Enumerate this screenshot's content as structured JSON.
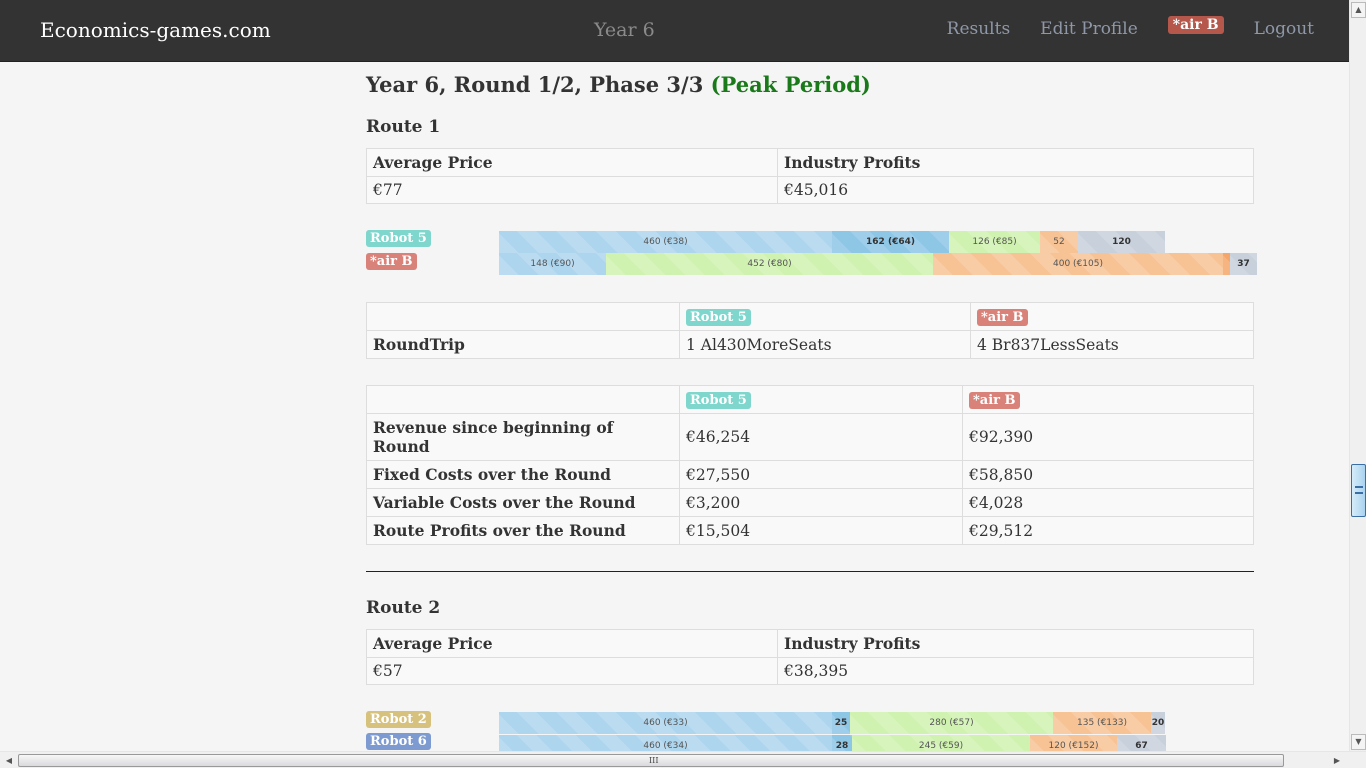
{
  "nav": {
    "brand": "Economics-games.com",
    "center": "Year 6",
    "links": [
      "Results",
      "Edit Profile"
    ],
    "user_badge": "*air B",
    "logout": "Logout"
  },
  "colors": {
    "robot5": "#7fd6cd",
    "airB": "#d9827a",
    "robot2": "#d7c27d",
    "robot6": "#7d9bd0",
    "seg_blue": "#aed5ee",
    "seg_blue_dark": "#8ec6e6",
    "seg_green": "#d0f2b0",
    "seg_orange": "#f7c395",
    "seg_orange_dark": "#f5a76a",
    "seg_gray": "#c8d0dc"
  },
  "heading": {
    "title": "Year 6, Round 1/2, Phase 3/3",
    "period": "(Peak Period)"
  },
  "route1": {
    "title": "Route 1",
    "summary": {
      "headers": [
        "Average Price",
        "Industry Profits"
      ],
      "values": [
        "€77",
        "€45,016"
      ]
    },
    "bars": [
      {
        "player": "Robot 5",
        "color_key": "robot5",
        "segments": [
          {
            "value": 460,
            "label": "460 (€38)",
            "color": "seg_blue",
            "bold": false
          },
          {
            "value": 162,
            "label": "162 (€64)",
            "color": "seg_blue_dark",
            "bold": true
          },
          {
            "value": 126,
            "label": "126 (€85)",
            "color": "seg_green",
            "bold": false
          },
          {
            "value": 52,
            "label": "52",
            "color": "seg_orange",
            "bold": false
          },
          {
            "value": 120,
            "label": "120",
            "color": "seg_gray",
            "bold": true
          }
        ]
      },
      {
        "player": "*air B",
        "color_key": "airB",
        "segments": [
          {
            "value": 148,
            "label": "148 (€90)",
            "color": "seg_blue",
            "bold": false
          },
          {
            "value": 452,
            "label": "452 (€80)",
            "color": "seg_green",
            "bold": false
          },
          {
            "value": 400,
            "label": "400 (€105)",
            "color": "seg_orange",
            "bold": false
          },
          {
            "value": 10,
            "label": "",
            "color": "seg_orange_dark",
            "bold": false
          },
          {
            "value": 37,
            "label": "37",
            "color": "seg_gray",
            "bold": true
          }
        ]
      }
    ],
    "aircraft": {
      "players": [
        "Robot 5",
        "*air B"
      ],
      "row_label": "RoundTrip",
      "values": [
        "1 Al430MoreSeats",
        "4 Br837LessSeats"
      ]
    },
    "financials": {
      "players": [
        "Robot 5",
        "*air B"
      ],
      "rows": [
        {
          "label": "Revenue since beginning of Round",
          "values": [
            "€46,254",
            "€92,390"
          ]
        },
        {
          "label": "Fixed Costs over the Round",
          "values": [
            "€27,550",
            "€58,850"
          ]
        },
        {
          "label": "Variable Costs over the Round",
          "values": [
            "€3,200",
            "€4,028"
          ]
        },
        {
          "label": "Route Profits over the Round",
          "values": [
            "€15,504",
            "€29,512"
          ]
        }
      ]
    }
  },
  "route2": {
    "title": "Route 2",
    "summary": {
      "headers": [
        "Average Price",
        "Industry Profits"
      ],
      "values": [
        "€57",
        "€38,395"
      ]
    },
    "bars": [
      {
        "player": "Robot 2",
        "color_key": "robot2",
        "segments": [
          {
            "value": 460,
            "label": "460 (€33)",
            "color": "seg_blue",
            "bold": false
          },
          {
            "value": 25,
            "label": "25",
            "color": "seg_blue_dark",
            "bold": true
          },
          {
            "value": 280,
            "label": "280 (€57)",
            "color": "seg_green",
            "bold": false
          },
          {
            "value": 135,
            "label": "135 (€133)",
            "color": "seg_orange",
            "bold": false
          },
          {
            "value": 20,
            "label": "20",
            "color": "seg_gray",
            "bold": true
          }
        ]
      },
      {
        "player": "Robot 6",
        "color_key": "robot6",
        "segments": [
          {
            "value": 460,
            "label": "460 (€34)",
            "color": "seg_blue",
            "bold": false
          },
          {
            "value": 28,
            "label": "28",
            "color": "seg_blue_dark",
            "bold": true
          },
          {
            "value": 245,
            "label": "245 (€59)",
            "color": "seg_green",
            "bold": false
          },
          {
            "value": 120,
            "label": "120 (€152)",
            "color": "seg_orange",
            "bold": false
          },
          {
            "value": 67,
            "label": "67",
            "color": "seg_gray",
            "bold": true
          }
        ]
      }
    ]
  }
}
